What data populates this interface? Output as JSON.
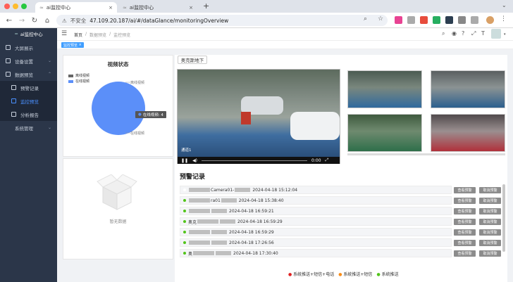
{
  "browser": {
    "tabs": [
      {
        "title": "ai监控中心",
        "active": true
      },
      {
        "title": "ai监控中心",
        "active": false
      }
    ],
    "new_tab": "+",
    "security_label": "不安全",
    "url": "47.109.20.187/ai/#/dataGlance/monitoringOverview"
  },
  "sidebar": {
    "logo": "ai监控中心",
    "items": [
      {
        "label": "大屏展示",
        "icon": "monitor-icon"
      },
      {
        "label": "设备设置",
        "icon": "device-icon"
      },
      {
        "label": "数据预览",
        "icon": "data-icon"
      },
      {
        "label": "预警记录",
        "icon": "alert-icon"
      },
      {
        "label": "监控预览",
        "icon": "camera-icon"
      },
      {
        "label": "分析报告",
        "icon": "report-icon"
      },
      {
        "label": "系统管理",
        "icon": "system-icon"
      }
    ]
  },
  "breadcrumb": {
    "home": "首页",
    "sep1": "/",
    "mid": "数据预览",
    "sep2": "/",
    "current": "监控预览"
  },
  "tag": "监控预览",
  "video_status": {
    "title": "视频状态",
    "legend": [
      {
        "label": "离线视频",
        "color": "#666666"
      },
      {
        "label": "在线视频",
        "color": "#5b8ff9"
      }
    ],
    "label_top": "离线视频",
    "label_bottom": "在线视频",
    "tooltip": "在线视频: 4"
  },
  "empty": {
    "text": "暂无数据"
  },
  "location_button": "奥克斯地下",
  "player": {
    "time": "0:00",
    "caption": "通道1"
  },
  "warnings": {
    "title": "预警记录",
    "rows": [
      {
        "prefix": "",
        "middle": "Camera01-",
        "time": "2024-04-18 15:12:04",
        "dot": "#ffffff"
      },
      {
        "prefix": "",
        "middle": "ra01",
        "time": "2024-04-18 15:38:40",
        "dot": "#52c41a"
      },
      {
        "prefix": "",
        "middle": "",
        "time": "2024-04-18 16:59:21",
        "dot": "#52c41a"
      },
      {
        "prefix": "奥克",
        "middle": "",
        "time": "2024-04-18 16:59:29",
        "dot": "#52c41a"
      },
      {
        "prefix": "",
        "middle": "",
        "time": "2024-04-18 16:59:29",
        "dot": "#52c41a"
      },
      {
        "prefix": "",
        "middle": "",
        "time": "2024-04-18 17:26:56",
        "dot": "#52c41a"
      },
      {
        "prefix": "奥",
        "middle": "",
        "time": "2024-04-18 17:30:40",
        "dot": "#52c41a"
      }
    ],
    "btn_view": "查看预警",
    "btn_cancel": "取消预警"
  },
  "footer_legend": [
    {
      "label": "系统推送+短信+电话",
      "color": "#e02020"
    },
    {
      "label": "系统推送+短信",
      "color": "#fa8c16"
    },
    {
      "label": "系统推送",
      "color": "#52c41a"
    }
  ],
  "chart_data": {
    "type": "pie",
    "title": "视频状态",
    "categories": [
      "离线视频",
      "在线视频"
    ],
    "values": [
      0,
      4
    ]
  }
}
